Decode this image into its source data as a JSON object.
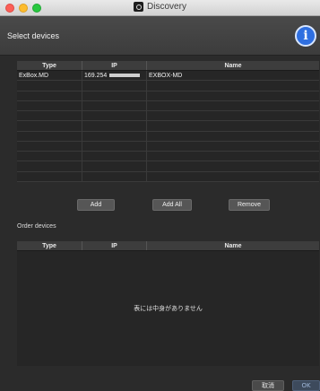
{
  "window": {
    "title": "Discovery",
    "app_icon": "discovery-app-icon"
  },
  "header": {
    "title": "Select devices",
    "info_icon": "info-icon",
    "info_glyph": "i",
    "info_color": "#2f6fe0"
  },
  "select_table": {
    "columns": [
      "Type",
      "IP",
      "Name"
    ],
    "rows": [
      {
        "type": "ExBox.MD",
        "ip": "169.254",
        "name": "EXBOX-MD"
      }
    ],
    "empty_row_count": 10
  },
  "actions": {
    "add": "Add",
    "add_all": "Add All",
    "remove": "Remove"
  },
  "order": {
    "label": "Order devices",
    "columns": [
      "Type",
      "IP",
      "Name"
    ],
    "empty_message": "表には中身がありません"
  },
  "footer": {
    "cancel": "取消",
    "ok": "OK",
    "ok_color": "#9fb7d9"
  }
}
